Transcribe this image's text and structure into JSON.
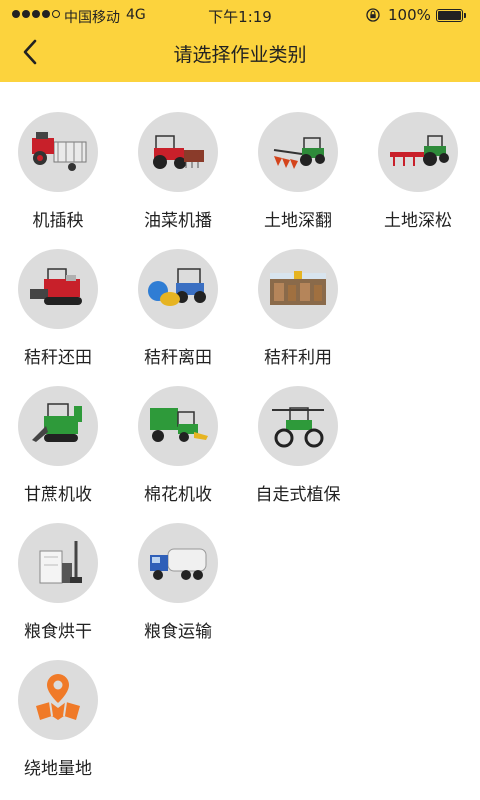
{
  "status_bar": {
    "carrier": "中国移动",
    "network": "4G",
    "time": "下午1:19",
    "battery": "100%"
  },
  "header": {
    "title": "请选择作业类别",
    "accent_color": "#fcd33d"
  },
  "categories": [
    {
      "label": "机插秧",
      "icon": "rice-transplanter-icon"
    },
    {
      "label": "油菜机播",
      "icon": "rapeseed-seeder-icon"
    },
    {
      "label": "土地深翻",
      "icon": "deep-plough-icon"
    },
    {
      "label": "土地深松",
      "icon": "subsoiler-icon"
    },
    {
      "label": "秸秆还田",
      "icon": "straw-return-harvester-icon"
    },
    {
      "label": "秸秆离田",
      "icon": "straw-baler-icon"
    },
    {
      "label": "秸秆利用",
      "icon": "straw-utilization-icon"
    },
    {
      "label": "甘蔗机收",
      "icon": "sugarcane-harvester-icon"
    },
    {
      "label": "棉花机收",
      "icon": "cotton-picker-icon"
    },
    {
      "label": "自走式植保",
      "icon": "sprayer-icon"
    },
    {
      "label": "粮食烘干",
      "icon": "grain-dryer-icon"
    },
    {
      "label": "粮食运输",
      "icon": "grain-truck-icon"
    },
    {
      "label": "绕地量地",
      "icon": "land-measure-icon"
    }
  ]
}
